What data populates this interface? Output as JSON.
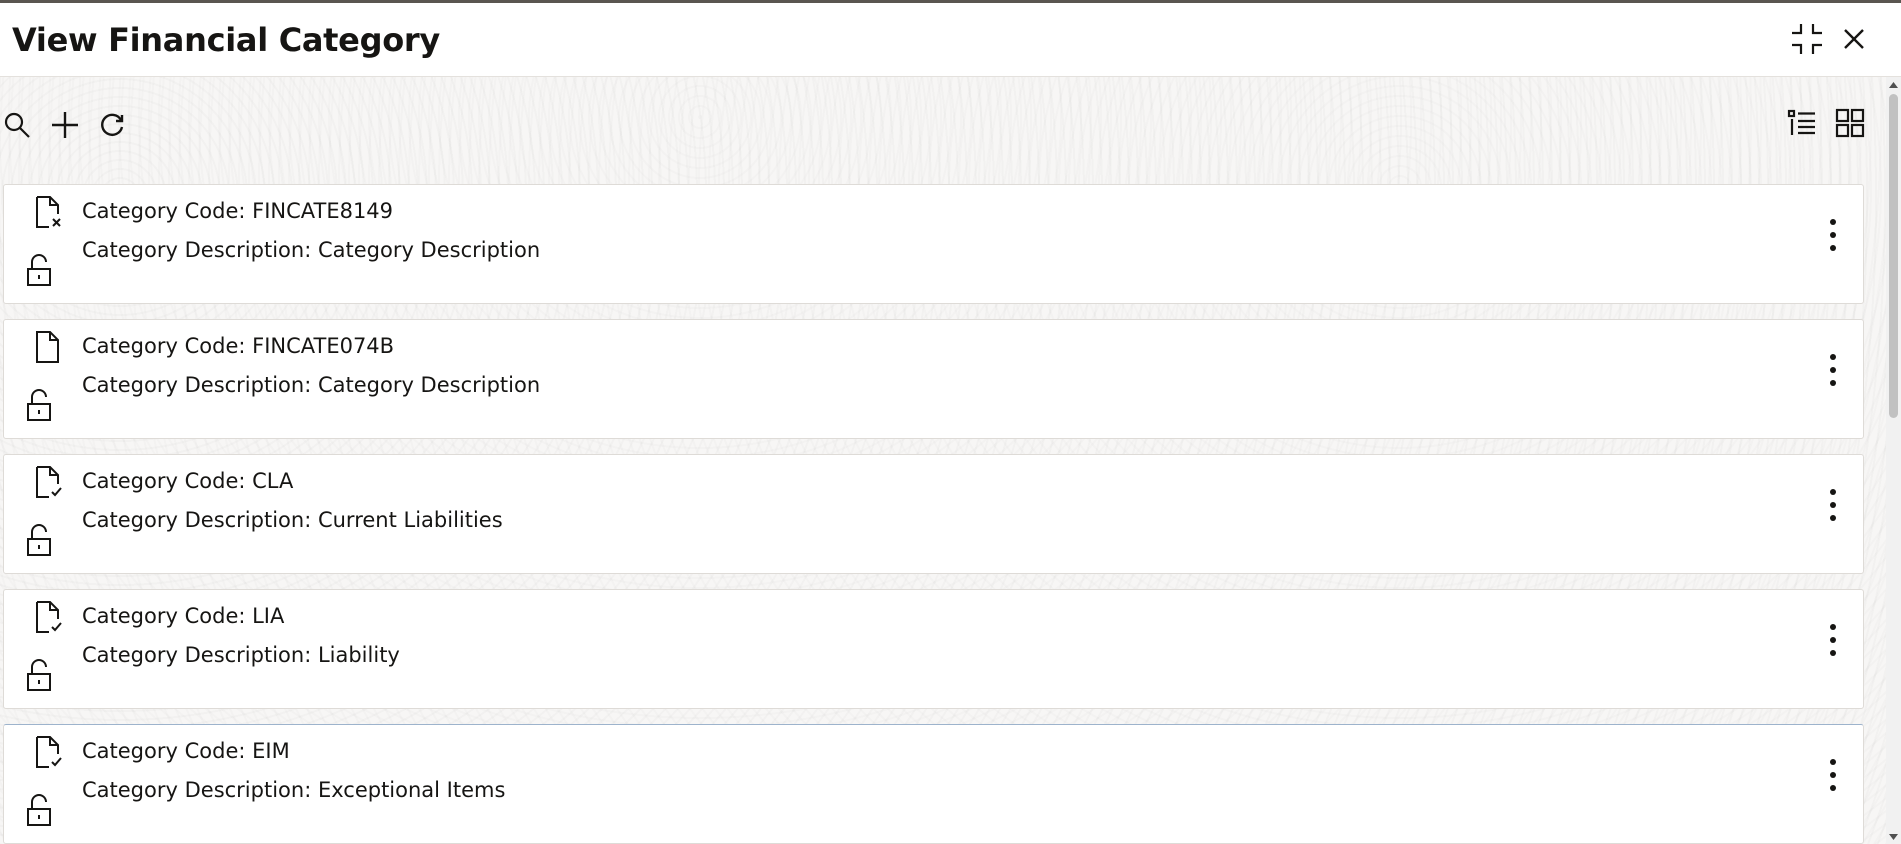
{
  "window": {
    "title": "View Financial Category"
  },
  "header": {
    "collapse_icon": "collapse-icon",
    "close_icon": "close-icon"
  },
  "toolbar": {
    "search_icon": "search-icon",
    "add_icon": "plus-icon",
    "refresh_icon": "refresh-icon",
    "list_view_icon": "list-view-icon",
    "tile_view_icon": "tile-view-icon"
  },
  "records": [
    {
      "code_text": "Category Code: FINCATE8149",
      "description_text": "Category Description: Category Description",
      "status_icon": "document-rejected-icon",
      "lock_icon": "unlock-icon"
    },
    {
      "code_text": "Category Code: FINCATE074B",
      "description_text": "Category Description: Category Description",
      "status_icon": "document-icon",
      "lock_icon": "unlock-icon"
    },
    {
      "code_text": "Category Code: CLA",
      "description_text": "Category Description: Current Liabilities",
      "status_icon": "document-authorized-icon",
      "lock_icon": "unlock-icon"
    },
    {
      "code_text": "Category Code: LIA",
      "description_text": "Category Description: Liability",
      "status_icon": "document-authorized-icon",
      "lock_icon": "unlock-icon"
    },
    {
      "code_text": "Category Code: EIM",
      "description_text": "Category Description: Exceptional Items",
      "status_icon": "document-authorized-icon",
      "lock_icon": "unlock-icon"
    }
  ],
  "colors": {
    "text": "#161513",
    "card_border": "#dedbd7",
    "header_bg": "#ffffff",
    "content_bg": "#f7f6f5"
  }
}
